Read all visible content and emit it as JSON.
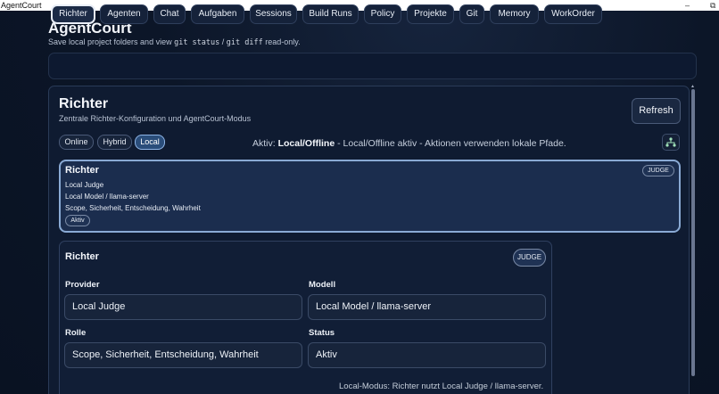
{
  "window": {
    "title": "AgentCourt",
    "minimize": "–",
    "restore": "⧉"
  },
  "header": {
    "title": "AgentCourt",
    "subtitle_pre": "Save local project folders and view ",
    "code1": "git status",
    "sep": " / ",
    "code2": "git diff",
    "subtitle_post": " read-only."
  },
  "tabs": [
    "Richter",
    "Agenten",
    "Chat",
    "Aufgaben",
    "Sessions",
    "Build Runs",
    "Policy",
    "Projekte",
    "Git",
    "Memory",
    "WorkOrder"
  ],
  "active_tab": "Richter",
  "section": {
    "title": "Richter",
    "subtitle": "Zentrale Richter-Konfiguration und AgentCourt-Modus",
    "refresh_label": "Refresh"
  },
  "modes": [
    "Online",
    "Hybrid",
    "Local"
  ],
  "active_mode": "Local",
  "status": {
    "prefix": "Aktiv: ",
    "mode": "Local/Offline",
    "text": " - Local/Offline aktiv - Aktionen verwenden lokale Pfade."
  },
  "agent_card": {
    "title": "Richter",
    "line1": "Local Judge",
    "line2": "Local Model / llama-server",
    "line3": "Scope, Sicherheit, Entscheidung, Wahrheit",
    "status_pill": "Aktiv",
    "badge": "JUDGE"
  },
  "form": {
    "title": "Richter",
    "badge": "JUDGE",
    "provider_label": "Provider",
    "provider_value": "Local Judge",
    "modell_label": "Modell",
    "modell_value": "Local Model / llama-server",
    "rolle_label": "Rolle",
    "rolle_value": "Scope, Sicherheit, Entscheidung, Wahrheit",
    "status_label": "Status",
    "status_value": "Aktiv",
    "footnote": "Local-Modus: Richter nutzt Local Judge / llama-server."
  },
  "colors": {
    "accent": "#8aaad4",
    "active_mode": "#2a4d7a",
    "background": "#0a1424"
  }
}
